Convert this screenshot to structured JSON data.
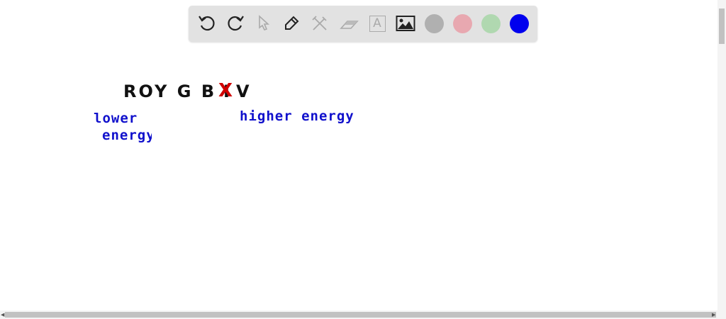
{
  "toolbar": {
    "tools": [
      "undo-icon",
      "redo-icon",
      "select-icon",
      "pen-icon",
      "tools-icon",
      "eraser-icon",
      "text-icon",
      "image-icon"
    ],
    "text_tool_label": "A",
    "colors": [
      "#b0b0b0",
      "#e8a8b0",
      "#b0d8b0",
      "#0000ee"
    ]
  },
  "canvas": {
    "mnemonic_part1": "ROY G B",
    "crossed_letter": "I",
    "cross_mark": "X",
    "mnemonic_part2": "V",
    "lower_label_line1": "lower",
    "lower_label_line2": "energy",
    "higher_label": "higher energy"
  }
}
